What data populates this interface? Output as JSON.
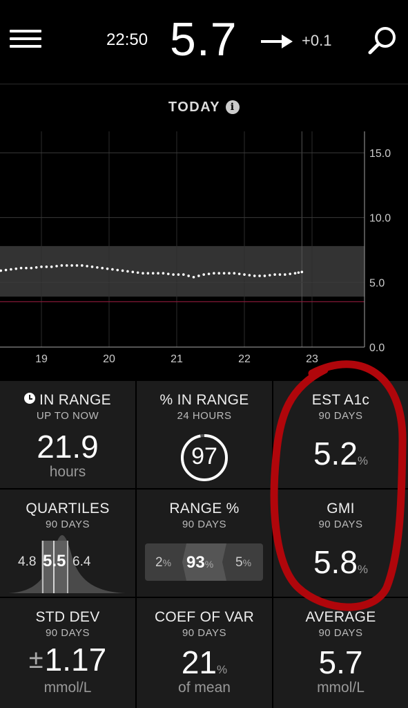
{
  "header": {
    "time": "22:50",
    "glucose": "5.7",
    "trend_arrow": "arrow-right-icon",
    "delta": "+0.1"
  },
  "chart": {
    "title": "TODAY",
    "info_icon": "i"
  },
  "chart_data": {
    "type": "scatter",
    "title": "TODAY",
    "x_tick_labels": [
      "19",
      "20",
      "21",
      "22",
      "23"
    ],
    "y_tick_labels": [
      "15.0",
      "10.0",
      "5.0",
      "0.0"
    ],
    "ylim": [
      0,
      16
    ],
    "target_range": [
      3.9,
      7.8
    ],
    "low_line": 3.5,
    "grid": true,
    "series": [
      {
        "x": [
          18.4,
          18.55,
          18.7,
          18.85,
          19.0,
          19.15,
          19.3,
          19.45,
          19.6,
          19.75,
          19.9,
          20.05,
          20.2,
          20.35,
          20.5,
          20.65,
          20.8,
          20.95,
          21.1,
          21.25,
          21.4,
          21.55,
          21.7,
          21.85,
          22.0,
          22.15,
          22.3,
          22.45,
          22.6,
          22.75,
          22.85
        ],
        "y": [
          5.9,
          6.0,
          6.1,
          6.1,
          6.2,
          6.2,
          6.3,
          6.3,
          6.3,
          6.2,
          6.1,
          6.0,
          5.9,
          5.8,
          5.7,
          5.7,
          5.7,
          5.6,
          5.6,
          5.4,
          5.6,
          5.7,
          5.7,
          5.7,
          5.6,
          5.5,
          5.5,
          5.6,
          5.6,
          5.7,
          5.8
        ]
      }
    ]
  },
  "tiles": {
    "in_range": {
      "label": "IN RANGE",
      "sub": "UP TO NOW",
      "value": "21.9",
      "unit": "hours"
    },
    "pct_in_range": {
      "label": "% IN RANGE",
      "sub": "24 HOURS",
      "value": "97"
    },
    "est_a1c": {
      "label": "EST A1c",
      "sub": "90 DAYS",
      "value": "5.2",
      "unit": "%"
    },
    "quartiles": {
      "label": "QUARTILES",
      "sub": "90 DAYS",
      "low": "4.8",
      "median": "5.5",
      "high": "6.4"
    },
    "range_pct": {
      "label": "RANGE %",
      "sub": "90 DAYS",
      "low": "2",
      "in": "93",
      "high": "5",
      "unit": "%"
    },
    "gmi": {
      "label": "GMI",
      "sub": "90 DAYS",
      "value": "5.8",
      "unit": "%"
    },
    "std_dev": {
      "label": "STD DEV",
      "sub": "90 DAYS",
      "sign": "±",
      "value": "1.17",
      "unit": "mmol/L"
    },
    "coef_var": {
      "label": "COEF OF VAR",
      "sub": "90 DAYS",
      "value": "21",
      "pct": "%",
      "unit": "of mean"
    },
    "average": {
      "label": "AVERAGE",
      "sub": "90 DAYS",
      "value": "5.7",
      "unit": "mmol/L"
    }
  },
  "colors": {
    "background": "#000000",
    "tile": "#1c1c1c",
    "target_band": "#333333",
    "low_line": "#8b1a3a",
    "annotation": "#b0060b"
  }
}
